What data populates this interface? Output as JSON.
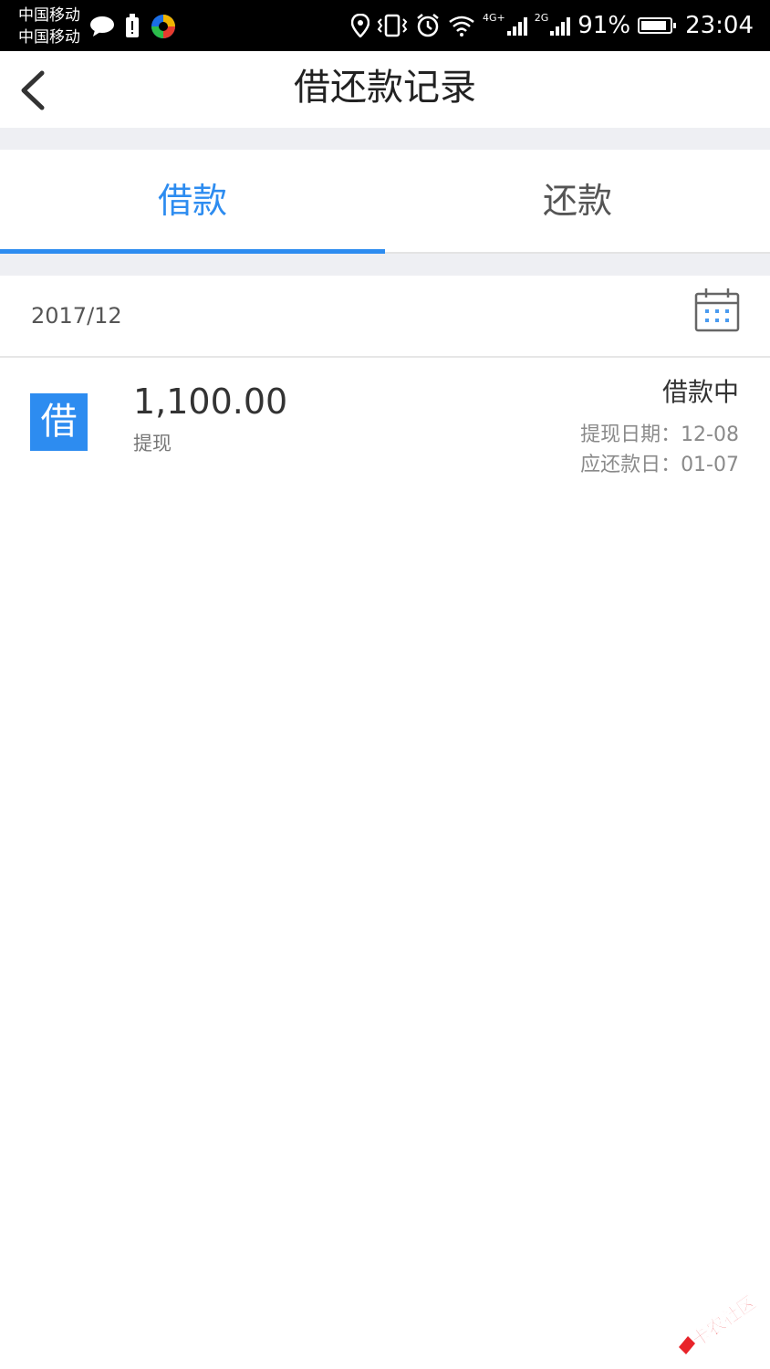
{
  "status_bar": {
    "carrier_1": "中国移动",
    "carrier_2": "中国移动",
    "network_a": "4G+",
    "network_b": "2G",
    "battery_percent_text": "91%",
    "battery_level": 0.91,
    "time": "23:04"
  },
  "header": {
    "title": "借还款记录"
  },
  "tabs": [
    {
      "label": "借款",
      "active": true
    },
    {
      "label": "还款",
      "active": false
    }
  ],
  "month": {
    "label": "2017/12"
  },
  "records": [
    {
      "badge": "借",
      "amount": "1,100.00",
      "type": "提现",
      "status": "借款中",
      "withdraw_date": "提现日期：12-08",
      "due_date": "应还款日：01-07"
    }
  ],
  "watermark": {
    "text": "卡农社区"
  },
  "colors": {
    "accent": "#2d8cf0",
    "watermark": "#e8242a"
  }
}
